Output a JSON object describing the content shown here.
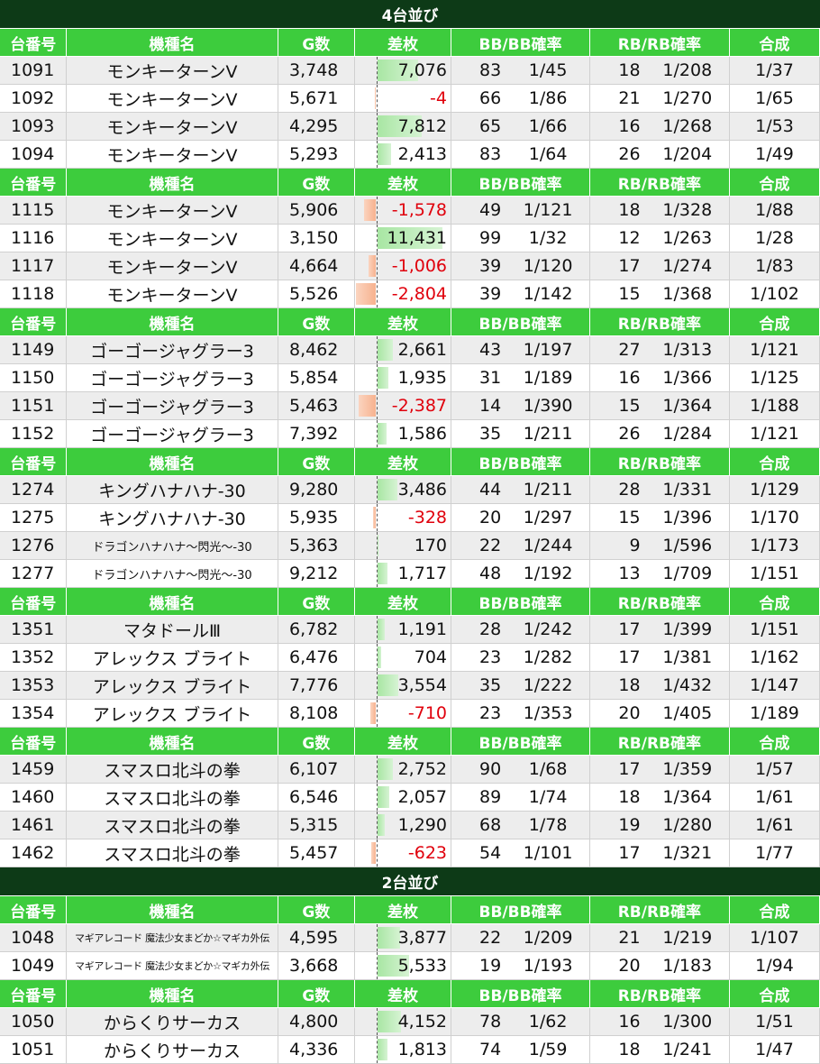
{
  "headers": [
    "台番号",
    "機種名",
    "G数",
    "差枚",
    "BB/BB確率",
    "RB/RB確率",
    "合成"
  ],
  "sections": [
    {
      "title": "4台並び",
      "groups": [
        {
          "rows": [
            {
              "no": "1091",
              "name": "モンキーターンV",
              "g": "3,748",
              "diff": "7,076",
              "diff_value": 7076,
              "bb": "83",
              "bb_rate": "1/45",
              "rb": "18",
              "rb_rate": "1/208",
              "comb": "1/37"
            },
            {
              "no": "1092",
              "name": "モンキーターンV",
              "g": "5,671",
              "diff": "-4",
              "diff_value": -4,
              "bb": "66",
              "bb_rate": "1/86",
              "rb": "21",
              "rb_rate": "1/270",
              "comb": "1/65"
            },
            {
              "no": "1093",
              "name": "モンキーターンV",
              "g": "4,295",
              "diff": "7,812",
              "diff_value": 7812,
              "bb": "65",
              "bb_rate": "1/66",
              "rb": "16",
              "rb_rate": "1/268",
              "comb": "1/53"
            },
            {
              "no": "1094",
              "name": "モンキーターンV",
              "g": "5,293",
              "diff": "2,413",
              "diff_value": 2413,
              "bb": "83",
              "bb_rate": "1/64",
              "rb": "26",
              "rb_rate": "1/204",
              "comb": "1/49"
            }
          ]
        },
        {
          "rows": [
            {
              "no": "1115",
              "name": "モンキーターンV",
              "g": "5,906",
              "diff": "-1,578",
              "diff_value": -1578,
              "bb": "49",
              "bb_rate": "1/121",
              "rb": "18",
              "rb_rate": "1/328",
              "comb": "1/88"
            },
            {
              "no": "1116",
              "name": "モンキーターンV",
              "g": "3,150",
              "diff": "11,431",
              "diff_value": 11431,
              "bb": "99",
              "bb_rate": "1/32",
              "rb": "12",
              "rb_rate": "1/263",
              "comb": "1/28"
            },
            {
              "no": "1117",
              "name": "モンキーターンV",
              "g": "4,664",
              "diff": "-1,006",
              "diff_value": -1006,
              "bb": "39",
              "bb_rate": "1/120",
              "rb": "17",
              "rb_rate": "1/274",
              "comb": "1/83"
            },
            {
              "no": "1118",
              "name": "モンキーターンV",
              "g": "5,526",
              "diff": "-2,804",
              "diff_value": -2804,
              "bb": "39",
              "bb_rate": "1/142",
              "rb": "15",
              "rb_rate": "1/368",
              "comb": "1/102"
            }
          ]
        },
        {
          "rows": [
            {
              "no": "1149",
              "name": "ゴーゴージャグラー3",
              "g": "8,462",
              "diff": "2,661",
              "diff_value": 2661,
              "bb": "43",
              "bb_rate": "1/197",
              "rb": "27",
              "rb_rate": "1/313",
              "comb": "1/121"
            },
            {
              "no": "1150",
              "name": "ゴーゴージャグラー3",
              "g": "5,854",
              "diff": "1,935",
              "diff_value": 1935,
              "bb": "31",
              "bb_rate": "1/189",
              "rb": "16",
              "rb_rate": "1/366",
              "comb": "1/125"
            },
            {
              "no": "1151",
              "name": "ゴーゴージャグラー3",
              "g": "5,463",
              "diff": "-2,387",
              "diff_value": -2387,
              "bb": "14",
              "bb_rate": "1/390",
              "rb": "15",
              "rb_rate": "1/364",
              "comb": "1/188"
            },
            {
              "no": "1152",
              "name": "ゴーゴージャグラー3",
              "g": "7,392",
              "diff": "1,586",
              "diff_value": 1586,
              "bb": "35",
              "bb_rate": "1/211",
              "rb": "26",
              "rb_rate": "1/284",
              "comb": "1/121"
            }
          ]
        },
        {
          "rows": [
            {
              "no": "1274",
              "name": "キングハナハナ-30",
              "g": "9,280",
              "diff": "3,486",
              "diff_value": 3486,
              "bb": "44",
              "bb_rate": "1/211",
              "rb": "28",
              "rb_rate": "1/331",
              "comb": "1/129"
            },
            {
              "no": "1275",
              "name": "キングハナハナ-30",
              "g": "5,935",
              "diff": "-328",
              "diff_value": -328,
              "bb": "20",
              "bb_rate": "1/297",
              "rb": "15",
              "rb_rate": "1/396",
              "comb": "1/170"
            },
            {
              "no": "1276",
              "name": "ドラゴンハナハナ～閃光～-30",
              "name_size": "small",
              "g": "5,363",
              "diff": "170",
              "diff_value": 170,
              "bb": "22",
              "bb_rate": "1/244",
              "rb": "9",
              "rb_rate": "1/596",
              "comb": "1/173"
            },
            {
              "no": "1277",
              "name": "ドラゴンハナハナ～閃光～-30",
              "name_size": "small",
              "g": "9,212",
              "diff": "1,717",
              "diff_value": 1717,
              "bb": "48",
              "bb_rate": "1/192",
              "rb": "13",
              "rb_rate": "1/709",
              "comb": "1/151"
            }
          ]
        },
        {
          "rows": [
            {
              "no": "1351",
              "name": "マタドールⅢ",
              "g": "6,782",
              "diff": "1,191",
              "diff_value": 1191,
              "bb": "28",
              "bb_rate": "1/242",
              "rb": "17",
              "rb_rate": "1/399",
              "comb": "1/151"
            },
            {
              "no": "1352",
              "name": "アレックス ブライト",
              "g": "6,476",
              "diff": "704",
              "diff_value": 704,
              "bb": "23",
              "bb_rate": "1/282",
              "rb": "17",
              "rb_rate": "1/381",
              "comb": "1/162"
            },
            {
              "no": "1353",
              "name": "アレックス ブライト",
              "g": "7,776",
              "diff": "3,554",
              "diff_value": 3554,
              "bb": "35",
              "bb_rate": "1/222",
              "rb": "18",
              "rb_rate": "1/432",
              "comb": "1/147"
            },
            {
              "no": "1354",
              "name": "アレックス ブライト",
              "g": "8,108",
              "diff": "-710",
              "diff_value": -710,
              "bb": "23",
              "bb_rate": "1/353",
              "rb": "20",
              "rb_rate": "1/405",
              "comb": "1/189"
            }
          ]
        },
        {
          "rows": [
            {
              "no": "1459",
              "name": "スマスロ北斗の拳",
              "g": "6,107",
              "diff": "2,752",
              "diff_value": 2752,
              "bb": "90",
              "bb_rate": "1/68",
              "rb": "17",
              "rb_rate": "1/359",
              "comb": "1/57"
            },
            {
              "no": "1460",
              "name": "スマスロ北斗の拳",
              "g": "6,546",
              "diff": "2,057",
              "diff_value": 2057,
              "bb": "89",
              "bb_rate": "1/74",
              "rb": "18",
              "rb_rate": "1/364",
              "comb": "1/61"
            },
            {
              "no": "1461",
              "name": "スマスロ北斗の拳",
              "g": "5,315",
              "diff": "1,290",
              "diff_value": 1290,
              "bb": "68",
              "bb_rate": "1/78",
              "rb": "19",
              "rb_rate": "1/280",
              "comb": "1/61"
            },
            {
              "no": "1462",
              "name": "スマスロ北斗の拳",
              "g": "5,457",
              "diff": "-623",
              "diff_value": -623,
              "bb": "54",
              "bb_rate": "1/101",
              "rb": "17",
              "rb_rate": "1/321",
              "comb": "1/77"
            }
          ]
        }
      ]
    },
    {
      "title": "2台並び",
      "groups": [
        {
          "rows": [
            {
              "no": "1048",
              "name": "マギアレコード 魔法少女まどか☆マギカ外伝",
              "name_size": "mini",
              "g": "4,595",
              "diff": "3,877",
              "diff_value": 3877,
              "bb": "22",
              "bb_rate": "1/209",
              "rb": "21",
              "rb_rate": "1/219",
              "comb": "1/107"
            },
            {
              "no": "1049",
              "name": "マギアレコード 魔法少女まどか☆マギカ外伝",
              "name_size": "mini",
              "g": "3,668",
              "diff": "5,533",
              "diff_value": 5533,
              "bb": "19",
              "bb_rate": "1/193",
              "rb": "20",
              "rb_rate": "1/183",
              "comb": "1/94"
            }
          ]
        },
        {
          "rows": [
            {
              "no": "1050",
              "name": "からくりサーカス",
              "g": "4,800",
              "diff": "4,152",
              "diff_value": 4152,
              "bb": "78",
              "bb_rate": "1/62",
              "rb": "16",
              "rb_rate": "1/300",
              "comb": "1/51"
            },
            {
              "no": "1051",
              "name": "からくりサーカス",
              "g": "4,336",
              "diff": "1,813",
              "diff_value": 1813,
              "bb": "74",
              "bb_rate": "1/59",
              "rb": "18",
              "rb_rate": "1/241",
              "comb": "1/47"
            }
          ]
        }
      ]
    }
  ],
  "colors": {
    "title_bg": "#0d3a17",
    "header_bg": "#3dcc3d",
    "positive_bar": "#a8e6a3",
    "negative_bar": "#f7b28f",
    "negative_text": "#e0000c",
    "alt_row": "#ededed"
  }
}
